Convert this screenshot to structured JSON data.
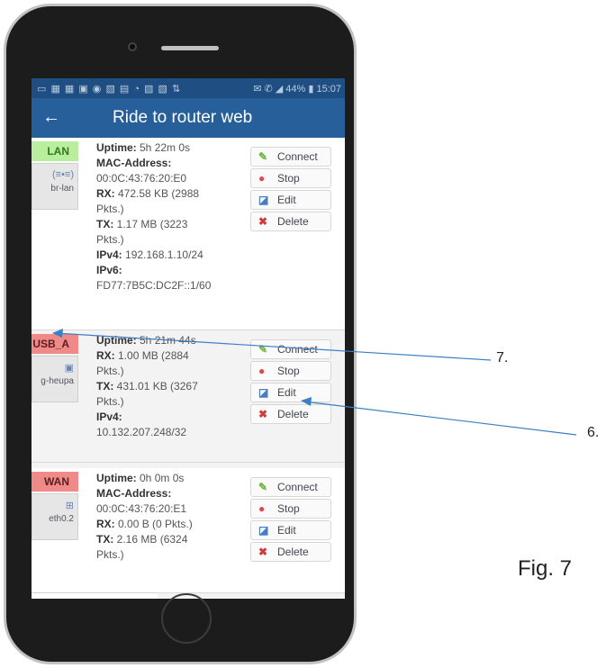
{
  "status_bar": {
    "icons": "▭ ▦ ▦ ▣ ◉ ▧ ▤ ◔ ▧ ▧ ⇅",
    "right": "✉ ✆ ◢ 44% ▮ 15:07"
  },
  "app_bar": {
    "back_icon": "back-arrow-icon",
    "title": "Ride to router web"
  },
  "interfaces": [
    {
      "name": "LAN",
      "status": "up",
      "device_icon": "network-bridge-icon",
      "device_glyph": "(≡•≡)",
      "device": "br-lan",
      "details": [
        {
          "label": "Uptime:",
          "value": " 5h 22m 0s"
        },
        {
          "label": "MAC-Address:",
          "value": ""
        },
        {
          "label": "",
          "value": "00:0C:43:76:20:E0"
        },
        {
          "label": "RX:",
          "value": " 472.58 KB (2988"
        },
        {
          "label": "",
          "value": "Pkts.)"
        },
        {
          "label": "TX:",
          "value": " 1.17 MB (3223"
        },
        {
          "label": "",
          "value": "Pkts.)"
        },
        {
          "label": "IPv4:",
          "value": " 192.168.1.10/24"
        },
        {
          "label": "IPv6:",
          "value": ""
        },
        {
          "label": "",
          "value": "FD77:7B5C:DC2F::1/60"
        }
      ]
    },
    {
      "name": "USB_A",
      "status": "down",
      "device_icon": "usb-modem-icon",
      "device_glyph": "▣",
      "device": "g-heupa",
      "details": [
        {
          "label": "Uptime:",
          "value": " 5h 21m 44s"
        },
        {
          "label": "RX:",
          "value": " 1.00 MB (2884"
        },
        {
          "label": "",
          "value": "Pkts.)"
        },
        {
          "label": "TX:",
          "value": " 431.01 KB (3267"
        },
        {
          "label": "",
          "value": "Pkts.)"
        },
        {
          "label": "IPv4:",
          "value": ""
        },
        {
          "label": "",
          "value": "10.132.207.248/32"
        }
      ]
    },
    {
      "name": "WAN",
      "status": "down",
      "device_icon": "ethernet-port-icon",
      "device_glyph": "⊞",
      "device": "eth0.2",
      "details": [
        {
          "label": "Uptime:",
          "value": " 0h 0m 0s"
        },
        {
          "label": "MAC-Address:",
          "value": ""
        },
        {
          "label": "",
          "value": "00:0C:43:76:20:E1"
        },
        {
          "label": "RX:",
          "value": " 0.00 B (0 Pkts.)"
        },
        {
          "label": "TX:",
          "value": " 2.16 MB (6324"
        },
        {
          "label": "",
          "value": "Pkts.)"
        }
      ]
    }
  ],
  "buttons": {
    "connect": {
      "label": "Connect",
      "icon": "connect-icon"
    },
    "stop": {
      "label": "Stop",
      "icon": "stop-icon"
    },
    "edit": {
      "label": "Edit",
      "icon": "edit-icon"
    },
    "delete": {
      "label": "Delete",
      "icon": "delete-icon"
    }
  },
  "annotations": [
    {
      "label": "7."
    },
    {
      "label": "6."
    }
  ],
  "figure_label": "Fig. 7",
  "colors": {
    "status_bar": "#1f4f82",
    "app_bar": "#275f9a",
    "badge_green": "#b9ee9e",
    "badge_red": "#f08a88",
    "callout_line": "#3b7fc4"
  }
}
